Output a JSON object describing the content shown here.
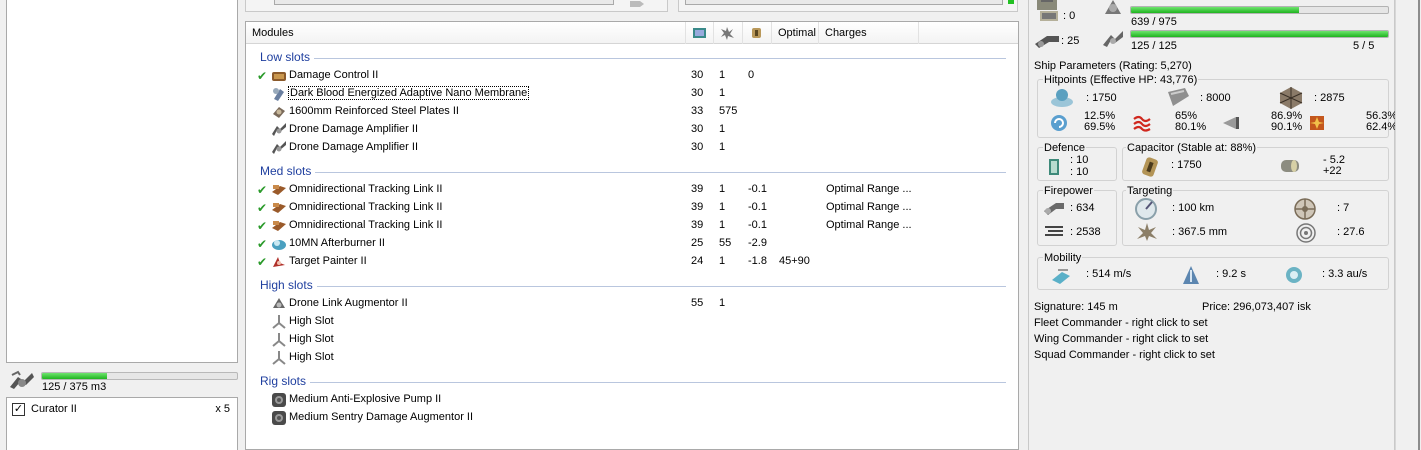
{
  "drone_bay": {
    "usage_text": "125 / 375 m3",
    "usage_fraction": 0.3333,
    "drones": [
      {
        "name": "Curator II",
        "quantity": "x 5",
        "checked": true
      }
    ]
  },
  "modules": {
    "columns": {
      "modules": "Modules",
      "optimal": "Optimal",
      "charges": "Charges"
    },
    "column_icons": [
      "cpu-icon",
      "powergrid-icon",
      "capacitor-use-icon"
    ],
    "low_slots": {
      "label": "Low slots",
      "items": [
        {
          "checked": true,
          "icon": "damage-control-icon",
          "name": "Damage Control II",
          "cpu": "30",
          "pg": "1",
          "cap": "0",
          "optimal": "",
          "charges": ""
        },
        {
          "checked": false,
          "icon": "nano-membrane-icon",
          "name": "Dark Blood Energized Adaptive Nano Membrane",
          "cpu": "30",
          "pg": "1",
          "cap": "",
          "optimal": "",
          "charges": ""
        },
        {
          "checked": false,
          "icon": "armor-plate-icon",
          "name": "1600mm Reinforced Steel Plates II",
          "cpu": "33",
          "pg": "575",
          "cap": "",
          "optimal": "",
          "charges": ""
        },
        {
          "checked": false,
          "icon": "drone-damage-amplifier-icon",
          "name": "Drone Damage Amplifier II",
          "cpu": "30",
          "pg": "1",
          "cap": "",
          "optimal": "",
          "charges": ""
        },
        {
          "checked": false,
          "icon": "drone-damage-amplifier-icon",
          "name": "Drone Damage Amplifier II",
          "cpu": "30",
          "pg": "1",
          "cap": "",
          "optimal": "",
          "charges": ""
        }
      ]
    },
    "med_slots": {
      "label": "Med slots",
      "items": [
        {
          "checked": true,
          "icon": "tracking-link-icon",
          "name": "Omnidirectional Tracking Link II",
          "cpu": "39",
          "pg": "1",
          "cap": "-0.1",
          "optimal": "",
          "charges": "Optimal Range ..."
        },
        {
          "checked": true,
          "icon": "tracking-link-icon",
          "name": "Omnidirectional Tracking Link II",
          "cpu": "39",
          "pg": "1",
          "cap": "-0.1",
          "optimal": "",
          "charges": "Optimal Range ..."
        },
        {
          "checked": true,
          "icon": "tracking-link-icon",
          "name": "Omnidirectional Tracking Link II",
          "cpu": "39",
          "pg": "1",
          "cap": "-0.1",
          "optimal": "",
          "charges": "Optimal Range ..."
        },
        {
          "checked": true,
          "icon": "afterburner-icon",
          "name": "10MN Afterburner II",
          "cpu": "25",
          "pg": "55",
          "cap": "-2.9",
          "optimal": "",
          "charges": ""
        },
        {
          "checked": true,
          "icon": "target-painter-icon",
          "name": "Target Painter II",
          "cpu": "24",
          "pg": "1",
          "cap": "-1.8",
          "optimal": "45+90",
          "charges": ""
        }
      ]
    },
    "high_slots": {
      "label": "High slots",
      "items": [
        {
          "checked": false,
          "icon": "drone-link-augmentor-icon",
          "name": "Drone Link Augmentor II",
          "cpu": "55",
          "pg": "1",
          "cap": "",
          "optimal": "",
          "charges": ""
        },
        {
          "checked": false,
          "icon": "empty-high-slot-icon",
          "name": "High Slot",
          "cpu": "",
          "pg": "",
          "cap": "",
          "optimal": "",
          "charges": ""
        },
        {
          "checked": false,
          "icon": "empty-high-slot-icon",
          "name": "High Slot",
          "cpu": "",
          "pg": "",
          "cap": "",
          "optimal": "",
          "charges": ""
        },
        {
          "checked": false,
          "icon": "empty-high-slot-icon",
          "name": "High Slot",
          "cpu": "",
          "pg": "",
          "cap": "",
          "optimal": "",
          "charges": ""
        }
      ]
    },
    "rig_slots": {
      "label": "Rig slots",
      "items": [
        {
          "checked": false,
          "icon": "rig-icon",
          "name": "Medium Anti-Explosive Pump II",
          "cpu": "",
          "pg": "",
          "cap": "",
          "optimal": "",
          "charges": ""
        },
        {
          "checked": false,
          "icon": "rig-icon",
          "name": "Medium Sentry Damage Augmentor II",
          "cpu": "",
          "pg": "",
          "cap": "",
          "optimal": "",
          "charges": ""
        }
      ]
    }
  },
  "resources": {
    "turret_hardpoints": ": 0",
    "launcher_hardpoints": ": 25",
    "cpu_text": "639 / 975",
    "cpu_fraction": 0.655,
    "drone_bandwidth_text": "125 / 125",
    "drone_bandwidth_fraction": 1.0,
    "drones_active": "5 / 5"
  },
  "ship": {
    "parameters_label": "Ship Parameters (Rating: 5,270)",
    "hitpoints": {
      "label": "Hitpoints (Effective HP: 43,776)",
      "shield": ": 1750",
      "armor": ": 8000",
      "structure": ": 2875",
      "em": [
        "12.5%",
        "69.5%"
      ],
      "thermal": [
        "65%",
        "80.1%"
      ],
      "kinetic": [
        "86.9%",
        "90.1%"
      ],
      "explosive": [
        "56.3%",
        "62.4%"
      ]
    },
    "defence": {
      "label": "Defence",
      "lines": [
        ": 10",
        ": 10"
      ]
    },
    "capacitor": {
      "label": "Capacitor (Stable at: 88%)",
      "capacity": ": 1750",
      "delta": [
        "- 5.2",
        "+22"
      ]
    },
    "firepower": {
      "label": "Firepower",
      "volley": ": 634",
      "dps": ": 2538"
    },
    "targeting": {
      "label": "Targeting",
      "range": ": 100 km",
      "max_targets": ": 7",
      "resolution": ": 367.5 mm",
      "sensor_strength": ": 27.6"
    },
    "mobility": {
      "label": "Mobility",
      "speed": ": 514 m/s",
      "align": ": 9.2 s",
      "warp": ": 3.3 au/s"
    },
    "signature": "Signature: 145 m",
    "price": "Price: 296,073,407 isk",
    "fleet_commander": "Fleet Commander - right click to set",
    "wing_commander": "Wing Commander - right click to set",
    "squad_commander": "Squad Commander - right click to set"
  },
  "colors": {
    "slot_header": "#1f3f9f",
    "bar_fill": "#1fb41f",
    "check": "#2a9a2a"
  }
}
